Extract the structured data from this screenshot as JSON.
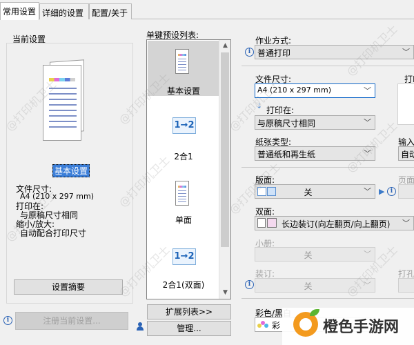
{
  "tabs": [
    "常用设置",
    "详细的设置",
    "配置/关于"
  ],
  "current_settings": {
    "title": "当前设置",
    "selected_name": "基本设置",
    "paper_size_label": "文件尺寸:",
    "paper_size_value": "A4 (210 x 297 mm)",
    "print_on_label": "打印在:",
    "print_on_value": "与原稿尺寸相同",
    "zoom_label": "缩小/放大:",
    "zoom_value": "自动配合打印尺寸",
    "summary_button": "设置摘要",
    "register_button": "注册当前设置..."
  },
  "preset_list": {
    "title": "单键预设列表:",
    "items": [
      {
        "label": "基本设置",
        "icon": "single-page-icon",
        "nup": ""
      },
      {
        "label": "2合1",
        "icon": "2up-icon",
        "nup": "1→2"
      },
      {
        "label": "单面",
        "icon": "single-page-icon",
        "nup": ""
      },
      {
        "label": "2合1(双面)",
        "icon": "2up-duplex-icon",
        "nup": "1→2"
      }
    ],
    "expand_button": "扩展列表>>",
    "manage_button": "管理..."
  },
  "settings": {
    "job_mode_label": "作业方式:",
    "job_mode_value": "普通打印",
    "page_size_label": "文件尺寸:",
    "page_size_value": "A4 (210 x 297 mm)",
    "print_on_label": "打印在:",
    "print_on_value": "与原稿尺寸相同",
    "paper_type_label": "纸张类型:",
    "paper_type_value": "普通纸和再生纸",
    "layout_label": "版面:",
    "layout_value": "关",
    "duplex_label": "双面:",
    "duplex_value": "长边装订(向左翻页/向上翻页)",
    "booklet_label": "小册:",
    "booklet_value": "关",
    "binding_label": "装订:",
    "binding_value": "关",
    "color_label": "彩色/黑白",
    "color_value": "彩",
    "right_print_label": "打印",
    "right_input_label": "输入",
    "right_input_value": "自动",
    "right_page_label": "页面",
    "right_punch_label": "打孔"
  },
  "watermark_text": "@打印机卫士",
  "brand": {
    "name": "橙色手游网"
  },
  "colors": {
    "accent": "#3b7ed8",
    "brand_orange": "#f39a1e"
  }
}
